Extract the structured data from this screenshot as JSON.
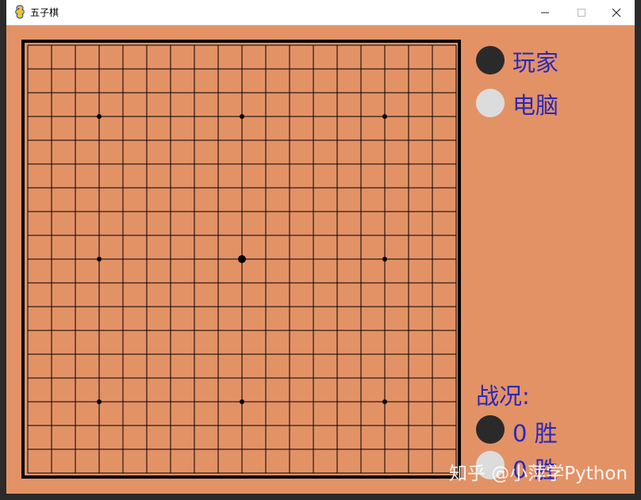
{
  "window": {
    "title": "五子棋",
    "minimize_icon": "minimize-icon",
    "maximize_icon": "maximize-icon",
    "close_icon": "close-icon"
  },
  "board": {
    "lines": 19,
    "star_points": [
      [
        3,
        3
      ],
      [
        3,
        9
      ],
      [
        3,
        15
      ],
      [
        9,
        3
      ],
      [
        9,
        9
      ],
      [
        9,
        15
      ],
      [
        15,
        3
      ],
      [
        15,
        9
      ],
      [
        15,
        15
      ]
    ],
    "center_point": [
      9,
      9
    ],
    "board_color": "#e39266",
    "line_color": "#000000"
  },
  "legend": {
    "player_label": "玩家",
    "player_color": "#2a2a2a",
    "computer_label": "电脑",
    "computer_color": "#dcdcdc"
  },
  "stats": {
    "title": "战况:",
    "player_wins": "0  胜",
    "computer_wins": "0  胜"
  },
  "watermark": "知乎 @小萍学Python"
}
